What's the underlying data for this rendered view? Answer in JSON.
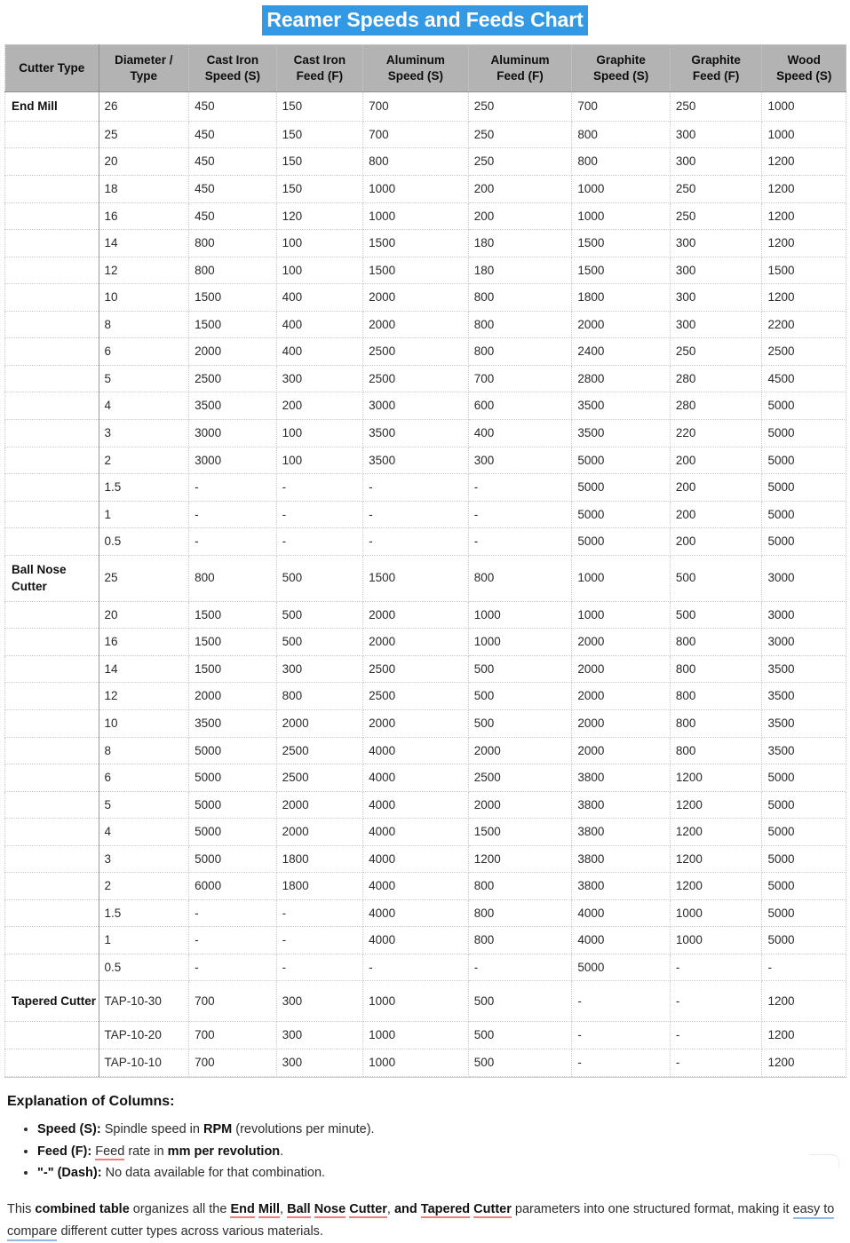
{
  "title": "Reamer Speeds and Feeds Chart",
  "table": {
    "headers": [
      "Cutter Type",
      "Diameter / Type",
      "Cast Iron Speed (S)",
      "Cast Iron Feed (F)",
      "Aluminum Speed (S)",
      "Aluminum Feed (F)",
      "Graphite Speed (S)",
      "Graphite Feed (F)",
      "Wood Speed (S)"
    ],
    "headers_lines": [
      [
        "Cutter Type",
        ""
      ],
      [
        "Diameter /",
        "Type"
      ],
      [
        "Cast Iron",
        "Speed (S)"
      ],
      [
        "Cast Iron",
        "Feed (F)"
      ],
      [
        "Aluminum",
        "Speed (S)"
      ],
      [
        "Aluminum",
        "Feed (F)"
      ],
      [
        "Graphite",
        "Speed (S)"
      ],
      [
        "Graphite",
        "Feed (F)"
      ],
      [
        "Wood",
        "Speed (S)"
      ]
    ],
    "rows": [
      {
        "group": "End Mill",
        "tall": false,
        "cells": [
          "26",
          "450",
          "150",
          "700",
          "250",
          "700",
          "250",
          "1000"
        ]
      },
      {
        "group": "",
        "tall": false,
        "cells": [
          "25",
          "450",
          "150",
          "700",
          "250",
          "800",
          "300",
          "1000"
        ]
      },
      {
        "group": "",
        "tall": false,
        "cells": [
          "20",
          "450",
          "150",
          "800",
          "250",
          "800",
          "300",
          "1200"
        ]
      },
      {
        "group": "",
        "tall": false,
        "cells": [
          "18",
          "450",
          "150",
          "1000",
          "200",
          "1000",
          "250",
          "1200"
        ]
      },
      {
        "group": "",
        "tall": false,
        "cells": [
          "16",
          "450",
          "120",
          "1000",
          "200",
          "1000",
          "250",
          "1200"
        ]
      },
      {
        "group": "",
        "tall": false,
        "cells": [
          "14",
          "800",
          "100",
          "1500",
          "180",
          "1500",
          "300",
          "1200"
        ]
      },
      {
        "group": "",
        "tall": false,
        "cells": [
          "12",
          "800",
          "100",
          "1500",
          "180",
          "1500",
          "300",
          "1500"
        ]
      },
      {
        "group": "",
        "tall": false,
        "cells": [
          "10",
          "1500",
          "400",
          "2000",
          "800",
          "1800",
          "300",
          "1200"
        ]
      },
      {
        "group": "",
        "tall": false,
        "cells": [
          "8",
          "1500",
          "400",
          "2000",
          "800",
          "2000",
          "300",
          "2200"
        ]
      },
      {
        "group": "",
        "tall": false,
        "cells": [
          "6",
          "2000",
          "400",
          "2500",
          "800",
          "2400",
          "250",
          "2500"
        ]
      },
      {
        "group": "",
        "tall": false,
        "cells": [
          "5",
          "2500",
          "300",
          "2500",
          "700",
          "2800",
          "280",
          "4500"
        ]
      },
      {
        "group": "",
        "tall": false,
        "cells": [
          "4",
          "3500",
          "200",
          "3000",
          "600",
          "3500",
          "280",
          "5000"
        ]
      },
      {
        "group": "",
        "tall": false,
        "cells": [
          "3",
          "3000",
          "100",
          "3500",
          "400",
          "3500",
          "220",
          "5000"
        ]
      },
      {
        "group": "",
        "tall": false,
        "cells": [
          "2",
          "3000",
          "100",
          "3500",
          "300",
          "5000",
          "200",
          "5000"
        ]
      },
      {
        "group": "",
        "tall": false,
        "cells": [
          "1.5",
          "-",
          "-",
          "-",
          "-",
          "5000",
          "200",
          "5000"
        ]
      },
      {
        "group": "",
        "tall": false,
        "cells": [
          "1",
          "-",
          "-",
          "-",
          "-",
          "5000",
          "200",
          "5000"
        ]
      },
      {
        "group": "",
        "tall": false,
        "cells": [
          "0.5",
          "-",
          "-",
          "-",
          "-",
          "5000",
          "200",
          "5000"
        ]
      },
      {
        "group": "Ball Nose Cutter",
        "tall": true,
        "cells": [
          "25",
          "800",
          "500",
          "1500",
          "800",
          "1000",
          "500",
          "3000"
        ]
      },
      {
        "group": "",
        "tall": false,
        "cells": [
          "20",
          "1500",
          "500",
          "2000",
          "1000",
          "1000",
          "500",
          "3000"
        ]
      },
      {
        "group": "",
        "tall": false,
        "cells": [
          "16",
          "1500",
          "500",
          "2000",
          "1000",
          "2000",
          "800",
          "3000"
        ]
      },
      {
        "group": "",
        "tall": false,
        "cells": [
          "14",
          "1500",
          "300",
          "2500",
          "500",
          "2000",
          "800",
          "3500"
        ]
      },
      {
        "group": "",
        "tall": false,
        "cells": [
          "12",
          "2000",
          "800",
          "2500",
          "500",
          "2000",
          "800",
          "3500"
        ]
      },
      {
        "group": "",
        "tall": false,
        "cells": [
          "10",
          "3500",
          "2000",
          "2000",
          "500",
          "2000",
          "800",
          "3500"
        ]
      },
      {
        "group": "",
        "tall": false,
        "cells": [
          "8",
          "5000",
          "2500",
          "4000",
          "2000",
          "2000",
          "800",
          "3500"
        ]
      },
      {
        "group": "",
        "tall": false,
        "cells": [
          "6",
          "5000",
          "2500",
          "4000",
          "2500",
          "3800",
          "1200",
          "5000"
        ]
      },
      {
        "group": "",
        "tall": false,
        "cells": [
          "5",
          "5000",
          "2000",
          "4000",
          "2000",
          "3800",
          "1200",
          "5000"
        ]
      },
      {
        "group": "",
        "tall": false,
        "cells": [
          "4",
          "5000",
          "2000",
          "4000",
          "1500",
          "3800",
          "1200",
          "5000"
        ]
      },
      {
        "group": "",
        "tall": false,
        "cells": [
          "3",
          "5000",
          "1800",
          "4000",
          "1200",
          "3800",
          "1200",
          "5000"
        ]
      },
      {
        "group": "",
        "tall": false,
        "cells": [
          "2",
          "6000",
          "1800",
          "4000",
          "800",
          "3800",
          "1200",
          "5000"
        ]
      },
      {
        "group": "",
        "tall": false,
        "cells": [
          "1.5",
          "-",
          "-",
          "4000",
          "800",
          "4000",
          "1000",
          "5000"
        ]
      },
      {
        "group": "",
        "tall": false,
        "cells": [
          "1",
          "-",
          "-",
          "4000",
          "800",
          "4000",
          "1000",
          "5000"
        ]
      },
      {
        "group": "",
        "tall": false,
        "cells": [
          "0.5",
          "-",
          "-",
          "-",
          "-",
          "5000",
          "-",
          "-"
        ]
      },
      {
        "group": "Tapered Cutter",
        "tall": true,
        "cells": [
          "TAP-10-30",
          "700",
          "300",
          "1000",
          "500",
          "-",
          "-",
          "1200"
        ]
      },
      {
        "group": "",
        "tall": false,
        "cells": [
          "TAP-10-20",
          "700",
          "300",
          "1000",
          "500",
          "-",
          "-",
          "1200"
        ]
      },
      {
        "group": "",
        "tall": false,
        "cells": [
          "TAP-10-10",
          "700",
          "300",
          "1000",
          "500",
          "-",
          "-",
          "1200"
        ]
      }
    ]
  },
  "explanation": {
    "heading": "Explanation of Columns:",
    "items": [
      {
        "term": "Speed (S):",
        "pre": " Spindle speed in ",
        "strong": "RPM",
        "post": " (revolutions per minute)."
      },
      {
        "term": "Feed (F):",
        "pre": " Feed rate in ",
        "strong": "mm per revolution",
        "post": "."
      },
      {
        "term": "\"-\" (Dash):",
        "pre": " No data available for that combination.",
        "strong": "",
        "post": ""
      }
    ]
  },
  "closing": {
    "p1": "This ",
    "b1": "combined table",
    "p2": " organizes all the ",
    "b2": "End Mill",
    "p3": ", ",
    "b3": "Ball Nose Cutter",
    "p4": ", ",
    "b4": "and Tapered Cutter",
    "p5": " parameters into one structured format, making it ",
    "u1": "easy to compare",
    "p6": " different cutter types across various materials."
  },
  "colors": {
    "title_highlight": "#3399e5",
    "title_text": "#ffffff",
    "header_bg": "#b3b3b3",
    "cell_border": "#cccccc",
    "spellcheck_red": "#f08080",
    "grammar_blue": "#8fb8e8"
  }
}
